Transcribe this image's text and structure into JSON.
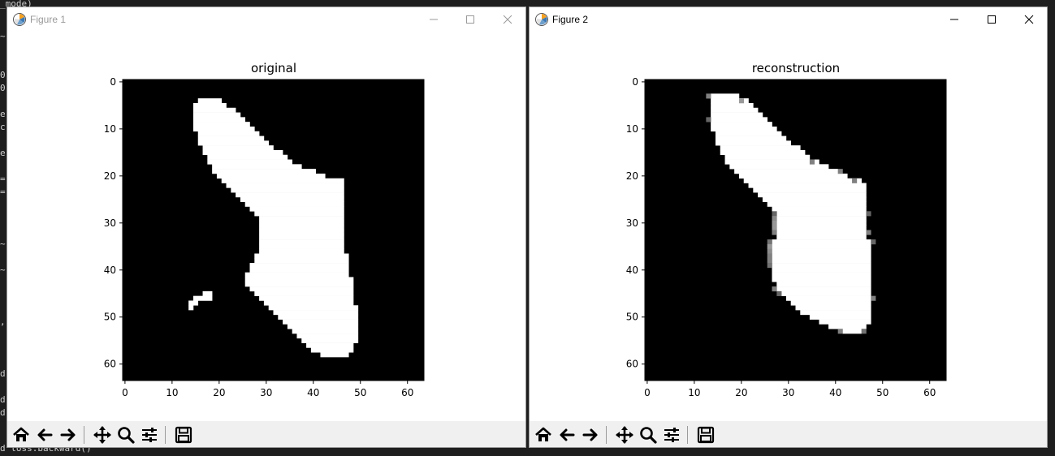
{
  "background": {
    "lines": [
      {
        "text": "_mode)",
        "y": 0
      },
      {
        "text": "~",
        "y": 40
      },
      {
        "text": "0",
        "y": 88
      },
      {
        "text": "0",
        "y": 104
      },
      {
        "text": "e",
        "y": 136
      },
      {
        "text": "c",
        "y": 152
      },
      {
        "text": "e",
        "y": 184
      },
      {
        "text": "=",
        "y": 216
      },
      {
        "text": "=",
        "y": 232
      },
      {
        "text": "~",
        "y": 296
      },
      {
        "text": "~",
        "y": 328
      },
      {
        "text": ",",
        "y": 392
      },
      {
        "text": "d",
        "y": 456
      },
      {
        "text": "d",
        "y": 488
      },
      {
        "text": "d",
        "y": 504
      },
      {
        "text": "d loss.backward()",
        "y": 548
      }
    ]
  },
  "windows": [
    {
      "title": "Figure 1",
      "active": false,
      "chart_data": {
        "type": "heatmap",
        "title": "original",
        "colormap": "gray",
        "shape": [
          64,
          64
        ],
        "xlim": [
          0,
          63
        ],
        "ylim": [
          63,
          0
        ],
        "xticks": [
          0,
          10,
          20,
          30,
          40,
          50,
          60
        ],
        "yticks": [
          0,
          10,
          20,
          30,
          40,
          50,
          60
        ],
        "value_range": [
          0,
          1
        ],
        "white_row_spans": [
          [
            4,
            16,
            20
          ],
          [
            5,
            15,
            21
          ],
          [
            6,
            15,
            23
          ],
          [
            7,
            15,
            24
          ],
          [
            8,
            15,
            25
          ],
          [
            9,
            15,
            26
          ],
          [
            10,
            15,
            27
          ],
          [
            11,
            16,
            28
          ],
          [
            12,
            16,
            29
          ],
          [
            13,
            16,
            30
          ],
          [
            14,
            17,
            31
          ],
          [
            15,
            17,
            33
          ],
          [
            16,
            18,
            34
          ],
          [
            17,
            18,
            35
          ],
          [
            18,
            19,
            37
          ],
          [
            19,
            19,
            40
          ],
          [
            20,
            20,
            42
          ],
          [
            21,
            21,
            46
          ],
          [
            22,
            22,
            46
          ],
          [
            23,
            23,
            46
          ],
          [
            24,
            24,
            46
          ],
          [
            25,
            25,
            46
          ],
          [
            26,
            26,
            46
          ],
          [
            27,
            27,
            46
          ],
          [
            28,
            28,
            46
          ],
          [
            29,
            29,
            46
          ],
          [
            30,
            29,
            46
          ],
          [
            31,
            29,
            46
          ],
          [
            32,
            29,
            46
          ],
          [
            33,
            29,
            46
          ],
          [
            34,
            29,
            46
          ],
          [
            35,
            29,
            46
          ],
          [
            36,
            29,
            46
          ],
          [
            37,
            28,
            47
          ],
          [
            38,
            28,
            47
          ],
          [
            39,
            27,
            47
          ],
          [
            40,
            27,
            47
          ],
          [
            41,
            26,
            47
          ],
          [
            42,
            26,
            48
          ],
          [
            43,
            26,
            48
          ],
          [
            44,
            27,
            48
          ],
          [
            45,
            28,
            48
          ],
          [
            46,
            29,
            48
          ],
          [
            47,
            30,
            48
          ],
          [
            48,
            31,
            49
          ],
          [
            49,
            32,
            49
          ],
          [
            50,
            33,
            49
          ],
          [
            51,
            34,
            49
          ],
          [
            52,
            35,
            49
          ],
          [
            53,
            36,
            49
          ],
          [
            54,
            37,
            49
          ],
          [
            55,
            38,
            49
          ],
          [
            56,
            39,
            48
          ],
          [
            57,
            40,
            48
          ],
          [
            58,
            42,
            47
          ],
          [
            45,
            17,
            18
          ],
          [
            46,
            15,
            18
          ],
          [
            47,
            14,
            15
          ],
          [
            48,
            14,
            14
          ]
        ],
        "gray_edges": []
      }
    },
    {
      "title": "Figure 2",
      "active": true,
      "chart_data": {
        "type": "heatmap",
        "title": "reconstruction",
        "colormap": "gray",
        "shape": [
          64,
          64
        ],
        "xlim": [
          0,
          63
        ],
        "ylim": [
          63,
          0
        ],
        "xticks": [
          0,
          10,
          20,
          30,
          40,
          50,
          60
        ],
        "yticks": [
          0,
          10,
          20,
          30,
          40,
          50,
          60
        ],
        "value_range": [
          0,
          1
        ],
        "white_row_spans": [
          [
            3,
            14,
            19
          ],
          [
            4,
            14,
            21
          ],
          [
            5,
            14,
            22
          ],
          [
            6,
            14,
            23
          ],
          [
            7,
            14,
            24
          ],
          [
            8,
            14,
            25
          ],
          [
            9,
            14,
            26
          ],
          [
            10,
            14,
            27
          ],
          [
            11,
            15,
            28
          ],
          [
            12,
            15,
            29
          ],
          [
            13,
            15,
            30
          ],
          [
            14,
            16,
            32
          ],
          [
            15,
            16,
            33
          ],
          [
            16,
            17,
            34
          ],
          [
            17,
            17,
            36
          ],
          [
            18,
            18,
            38
          ],
          [
            19,
            19,
            40
          ],
          [
            20,
            20,
            42
          ],
          [
            21,
            21,
            45
          ],
          [
            22,
            22,
            46
          ],
          [
            23,
            23,
            46
          ],
          [
            24,
            24,
            46
          ],
          [
            25,
            25,
            46
          ],
          [
            26,
            26,
            46
          ],
          [
            27,
            27,
            46
          ],
          [
            28,
            28,
            46
          ],
          [
            29,
            28,
            46
          ],
          [
            30,
            28,
            46
          ],
          [
            31,
            28,
            46
          ],
          [
            32,
            28,
            46
          ],
          [
            33,
            28,
            46
          ],
          [
            34,
            27,
            47
          ],
          [
            35,
            27,
            47
          ],
          [
            36,
            27,
            47
          ],
          [
            37,
            27,
            47
          ],
          [
            38,
            27,
            47
          ],
          [
            39,
            27,
            47
          ],
          [
            40,
            27,
            47
          ],
          [
            41,
            27,
            47
          ],
          [
            42,
            27,
            47
          ],
          [
            43,
            28,
            47
          ],
          [
            44,
            28,
            47
          ],
          [
            45,
            29,
            47
          ],
          [
            46,
            30,
            47
          ],
          [
            47,
            31,
            47
          ],
          [
            48,
            32,
            47
          ],
          [
            49,
            33,
            47
          ],
          [
            50,
            35,
            47
          ],
          [
            51,
            37,
            47
          ],
          [
            52,
            39,
            46
          ],
          [
            53,
            42,
            45
          ]
        ],
        "gray_edges": [
          [
            3,
            13,
            0.5
          ],
          [
            4,
            20,
            0.6
          ],
          [
            8,
            13,
            0.4
          ],
          [
            17,
            35,
            0.5
          ],
          [
            19,
            41,
            0.5
          ],
          [
            21,
            44,
            0.5
          ],
          [
            28,
            27,
            0.4
          ],
          [
            29,
            27,
            0.55
          ],
          [
            30,
            27,
            0.6
          ],
          [
            31,
            27,
            0.6
          ],
          [
            32,
            27,
            0.5
          ],
          [
            34,
            26,
            0.45
          ],
          [
            35,
            26,
            0.6
          ],
          [
            36,
            26,
            0.55
          ],
          [
            37,
            26,
            0.5
          ],
          [
            38,
            26,
            0.5
          ],
          [
            39,
            26,
            0.45
          ],
          [
            28,
            47,
            0.4
          ],
          [
            32,
            47,
            0.5
          ],
          [
            34,
            48,
            0.4
          ],
          [
            44,
            27,
            0.5
          ],
          [
            45,
            28,
            0.4
          ],
          [
            46,
            48,
            0.5
          ],
          [
            53,
            41,
            0.5
          ],
          [
            53,
            46,
            0.45
          ]
        ]
      }
    }
  ],
  "toolbar": {
    "buttons": [
      "home-icon",
      "back-icon",
      "forward-icon",
      "pan-icon",
      "zoom-icon",
      "configure-icon",
      "save-icon"
    ]
  }
}
